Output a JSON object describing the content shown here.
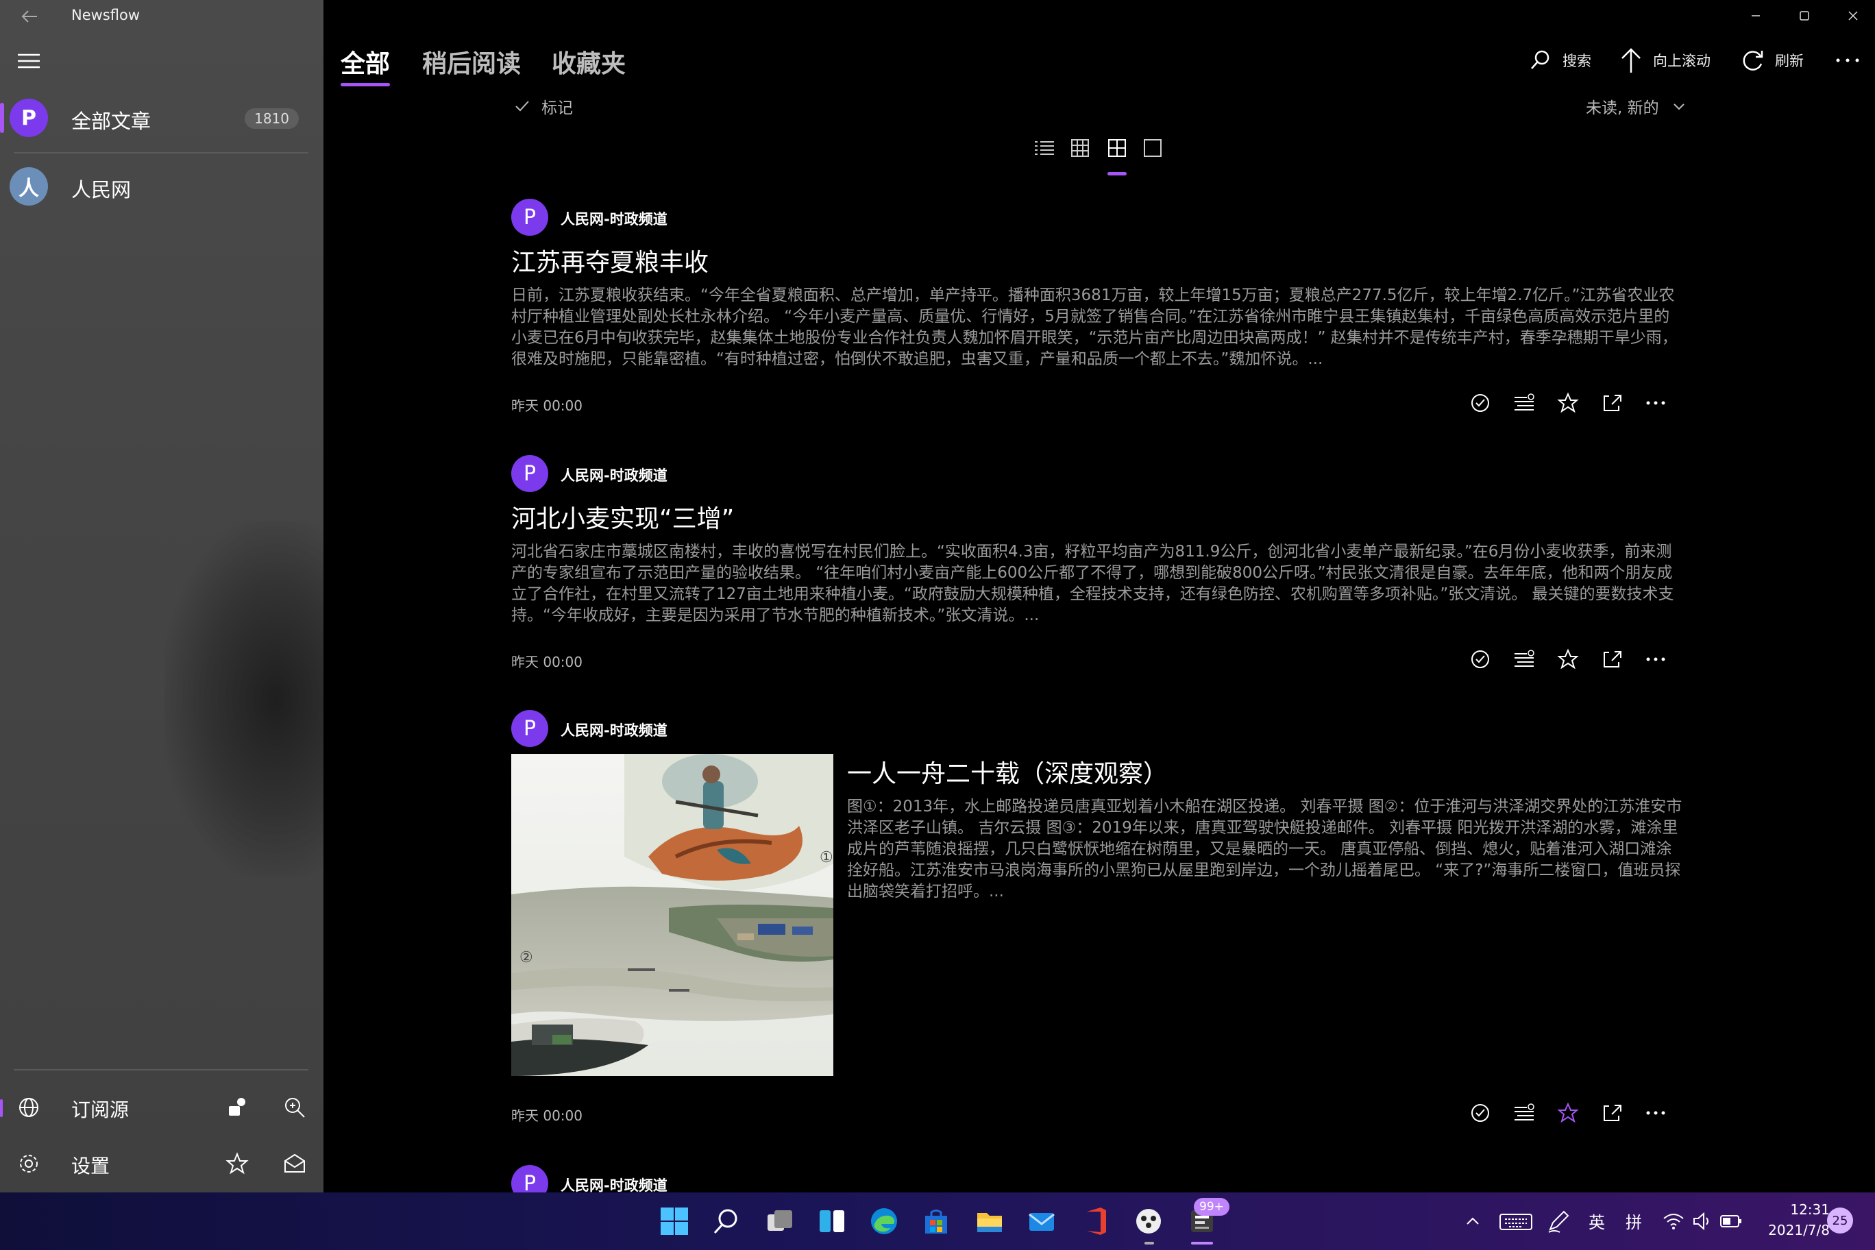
{
  "app": {
    "title": "Newsflow"
  },
  "sidebar": {
    "items": [
      {
        "avatar": "P",
        "label": "全部文章",
        "count": "1810"
      },
      {
        "avatar": "人",
        "label": "人民网"
      }
    ],
    "bottom": {
      "subscriptions_label": "订阅源",
      "settings_label": "设置"
    }
  },
  "tabs": [
    {
      "label": "全部"
    },
    {
      "label": "稍后阅读"
    },
    {
      "label": "收藏夹"
    }
  ],
  "commands": {
    "search": "搜索",
    "scroll_top": "向上滚动",
    "refresh": "刷新"
  },
  "filter": {
    "mark_label": "标记",
    "sort_label": "未读, 新的"
  },
  "articles": [
    {
      "source": "人民网-时政频道",
      "source_avatar": "P",
      "title": "江苏再夺夏粮丰收",
      "summary": "日前，江苏夏粮收获结束。“今年全省夏粮面积、总产增加，单产持平。播种面积3681万亩，较上年增15万亩；夏粮总产277.5亿斤，较上年增2.7亿斤。”江苏省农业农村厅种植业管理处副处长杜永林介绍。 “今年小麦产量高、质量优、行情好，5月就签了销售合同。”在江苏省徐州市睢宁县王集镇赵集村，千亩绿色高质高效示范片里的小麦已在6月中旬收获完毕，赵集集体土地股份专业合作社负责人魏加怀眉开眼笑，“示范片亩产比周边田块高两成！” 赵集村并不是传统丰产村，春季孕穗期干旱少雨，很难及时施肥，只能靠密植。“有时种植过密，怕倒伏不敢追肥，虫害又重，产量和品质一个都上不去。”魏加怀说。...",
      "time": "昨天 00:00"
    },
    {
      "source": "人民网-时政频道",
      "source_avatar": "P",
      "title": "河北小麦实现“三增”",
      "summary": "河北省石家庄市藁城区南楼村，丰收的喜悦写在村民们脸上。“实收面积4.3亩，籽粒平均亩产为811.9公斤，创河北省小麦单产最新纪录。”在6月份小麦收获季，前来测产的专家组宣布了示范田产量的验收结果。 “往年咱们村小麦亩产能上600公斤都了不得了，哪想到能破800公斤呀。”村民张文清很是自豪。去年年底，他和两个朋友成立了合作社，在村里又流转了127亩土地用来种植小麦。“政府鼓励大规模种植，全程技术支持，还有绿色防控、农机购置等多项补贴。”张文清说。 最关键的要数技术支持。“今年收成好，主要是因为采用了节水节肥的种植新技术。”张文清说。...",
      "time": "昨天 00:00"
    },
    {
      "source": "人民网-时政频道",
      "source_avatar": "P",
      "title": "一人一舟二十载（深度观察）",
      "summary": "图①：2013年，水上邮路投递员唐真亚划着小木船在湖区投递。 刘春平摄 图②：位于淮河与洪泽湖交界处的江苏淮安市洪泽区老子山镇。 吉尔云摄 图③：2019年以来，唐真亚驾驶快艇投递邮件。 刘春平摄 阳光拨开洪泽湖的水雾，滩涂里成片的芦苇随浪摇摆，几只白鹭恹恹地缩在树荫里，又是暴晒的一天。 唐真亚停船、倒挡、熄火，贴着淮河入湖口滩涂拴好船。江苏淮安市马浪岗海事所的小黑狗已从屋里跑到岸边，一个劲儿摇着尾巴。 “来了?”海事所二楼窗口，值班员探出脑袋笑着打招呼。...",
      "time": "昨天 00:00",
      "image_markers": [
        "①",
        "②"
      ]
    },
    {
      "source": "人民网-时政频道",
      "source_avatar": "P"
    }
  ],
  "taskbar": {
    "badge": "99+",
    "tray_ime_1": "英",
    "tray_ime_2": "拼",
    "time": "12:31",
    "date": "2021/7/8",
    "notifications": "25"
  },
  "colors": {
    "accent": "#a855f7",
    "avatar": "#7c3aed",
    "sidebar_bg": "#454545",
    "main_bg": "#000000"
  }
}
